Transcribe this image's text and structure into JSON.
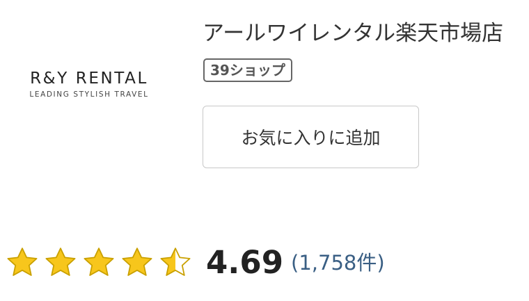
{
  "logo": {
    "name": "R&Y RENTAL",
    "tagline": "LEADING STYLISH TRAVEL"
  },
  "shop": {
    "name": "アールワイレンタル楽天市場店",
    "badge": "39ショップ"
  },
  "favorite_button": {
    "label": "お気に入りに追加"
  },
  "rating": {
    "value": "4.69",
    "count": "(1,758件)",
    "stars": 4.69,
    "max_stars": 5,
    "star_color": "#f7c61c",
    "star_outline": "#c9a000"
  }
}
